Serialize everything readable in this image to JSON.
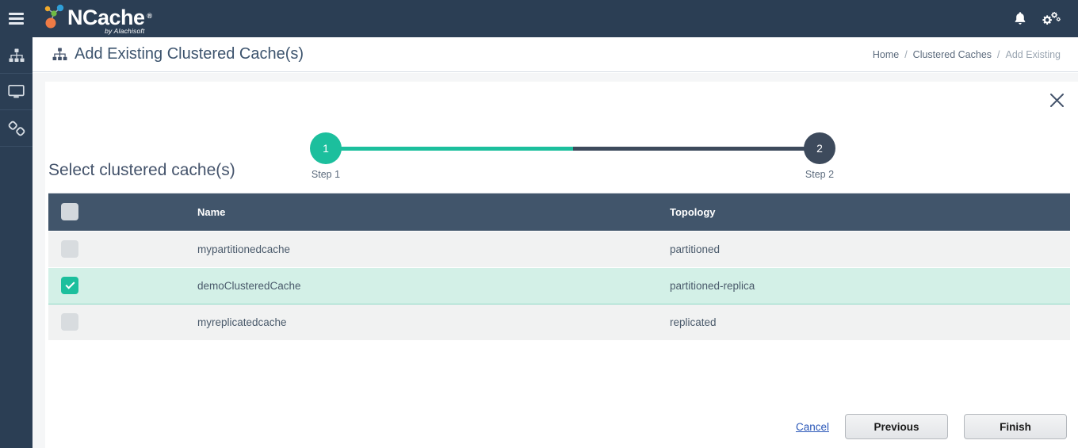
{
  "topbar": {
    "menu_icon": "hamburger-icon",
    "logo": {
      "word_n": "N",
      "word_rest": "Cache",
      "registered": "®",
      "tagline": "by Alachisoft"
    },
    "notifications_icon": "bell-icon",
    "settings_icon": "gears-icon"
  },
  "sidebar": {
    "items": [
      {
        "name": "sidebar-item-clusters",
        "icon": "cluster-icon"
      },
      {
        "name": "sidebar-item-monitor",
        "icon": "monitor-icon"
      },
      {
        "name": "sidebar-item-links",
        "icon": "link-icon"
      }
    ]
  },
  "pagehead": {
    "icon": "cluster-icon",
    "title": "Add Existing Clustered Cache(s)",
    "breadcrumb": {
      "home": "Home",
      "sep1": "/",
      "clustered_caches": "Clustered Caches",
      "sep2": "/",
      "current": "Add Existing"
    }
  },
  "wizard": {
    "close_icon": "close-icon",
    "steps": [
      {
        "number": "1",
        "label": "Step 1",
        "state": "active"
      },
      {
        "number": "2",
        "label": "Step 2",
        "state": "inactive"
      }
    ],
    "section_title": "Select clustered cache(s)",
    "colors": {
      "active": "#1cbf9d",
      "inactive": "#3d4a5c",
      "selected_row_bg": "#d3f0e7",
      "header_bg": "#41556b",
      "topbar_bg": "#2b3e54"
    }
  },
  "table": {
    "headers": {
      "select_all": "",
      "name": "Name",
      "topology": "Topology"
    },
    "rows": [
      {
        "checked": false,
        "name": "mypartitionedcache",
        "topology": "partitioned"
      },
      {
        "checked": true,
        "name": "demoClusteredCache",
        "topology": "partitioned-replica"
      },
      {
        "checked": false,
        "name": "myreplicatedcache",
        "topology": "replicated"
      }
    ]
  },
  "footer": {
    "cancel": "Cancel",
    "previous": "Previous",
    "finish": "Finish"
  }
}
